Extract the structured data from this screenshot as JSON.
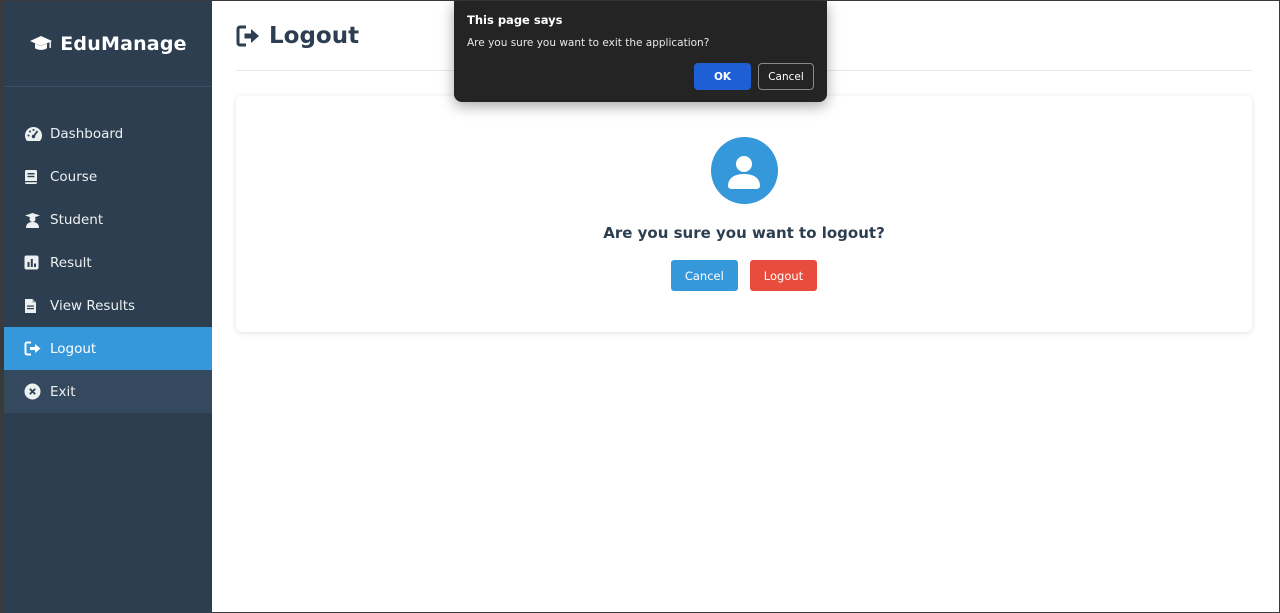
{
  "sidebar": {
    "brand": "EduManage",
    "brand_icon": "graduation-cap-icon",
    "items": [
      {
        "label": "Dashboard",
        "icon": "gauge-icon"
      },
      {
        "label": "Course",
        "icon": "book-icon"
      },
      {
        "label": "Student",
        "icon": "student-icon"
      },
      {
        "label": "Result",
        "icon": "bar-chart-icon"
      },
      {
        "label": "View Results",
        "icon": "document-icon"
      },
      {
        "label": "Logout",
        "icon": "sign-out-icon",
        "active": true
      },
      {
        "label": "Exit",
        "icon": "close-circle-icon"
      }
    ]
  },
  "main": {
    "title": "Logout",
    "title_icon": "sign-out-icon",
    "question": "Are you sure you want to logout?",
    "cancel_label": "Cancel",
    "logout_label": "Logout"
  },
  "dialog": {
    "title": "This page says",
    "message": "Are you sure you want to exit the application?",
    "ok_label": "OK",
    "cancel_label": "Cancel"
  },
  "colors": {
    "sidebar_bg": "#2c3e50",
    "active": "#3498db",
    "danger": "#e74c3c",
    "dialog_bg": "#242424",
    "dialog_ok": "#1f5fd6"
  }
}
